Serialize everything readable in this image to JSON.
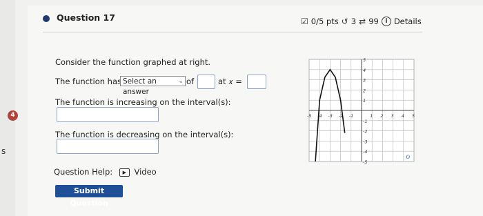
{
  "question": {
    "title": "Question 17",
    "points": "0/5 pts",
    "retry_count": "3",
    "attempts": "99",
    "details_label": "Details"
  },
  "body": {
    "prompt": "Consider the function graphed at right.",
    "has_a_prefix": "The function has a",
    "select_value": "Select an answer",
    "of_label": "of",
    "at_label": "at 𝑥 =",
    "increasing_label": "The function is increasing on the interval(s):",
    "decreasing_label": "The function is decreasing on the interval(s):"
  },
  "help": {
    "label": "Question Help:",
    "video_label": "Video"
  },
  "submit_label": "Submit Question",
  "side": {
    "badge": "4",
    "edge_letter": "s"
  },
  "chart_data": {
    "type": "line",
    "xlim": [
      -5,
      5
    ],
    "ylim": [
      -5,
      5
    ],
    "x_ticks": [
      "-5",
      "-4",
      "-3",
      "-2",
      "-1",
      "1",
      "2",
      "3",
      "4",
      "5"
    ],
    "y_ticks": [
      "5",
      "4",
      "3",
      "2",
      "1",
      "-1",
      "-2",
      "-3",
      "-4",
      "-5"
    ],
    "grid": true,
    "series": [
      {
        "x": [
          -4.4,
          -4.0,
          -3.5,
          -3.0,
          -2.5,
          -2.0,
          -1.6
        ],
        "y": [
          -5.0,
          1.0,
          3.25,
          4.0,
          3.25,
          1.0,
          -2.2
        ]
      }
    ],
    "annotation": "ℴ"
  }
}
